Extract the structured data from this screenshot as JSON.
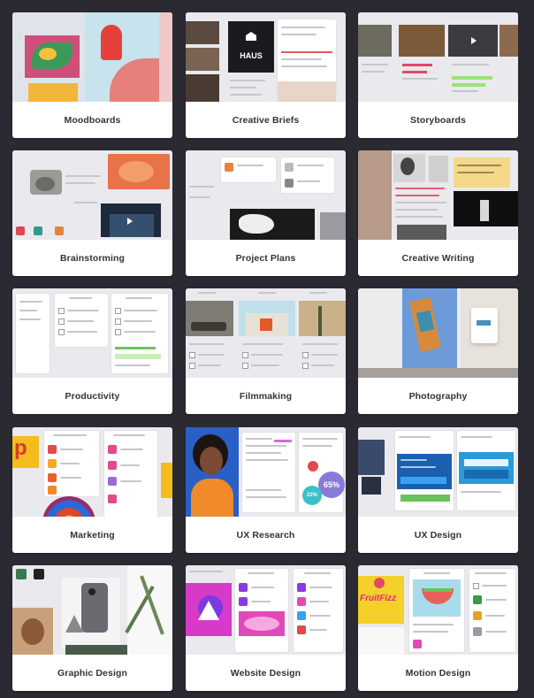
{
  "cards": [
    {
      "id": "moodboards",
      "label": "Moodboards"
    },
    {
      "id": "creative-briefs",
      "label": "Creative Briefs",
      "thumb_text": "HAUS"
    },
    {
      "id": "storyboards",
      "label": "Storyboards"
    },
    {
      "id": "brainstorming",
      "label": "Brainstorming"
    },
    {
      "id": "project-plans",
      "label": "Project Plans"
    },
    {
      "id": "creative-writing",
      "label": "Creative Writing"
    },
    {
      "id": "productivity",
      "label": "Productivity"
    },
    {
      "id": "filmmaking",
      "label": "Filmmaking"
    },
    {
      "id": "photography",
      "label": "Photography"
    },
    {
      "id": "marketing",
      "label": "Marketing",
      "thumb_text": "p"
    },
    {
      "id": "ux-research",
      "label": "UX Research",
      "thumb_text": "65%",
      "thumb_text2": "22%"
    },
    {
      "id": "ux-design",
      "label": "UX Design"
    },
    {
      "id": "graphic-design",
      "label": "Graphic Design"
    },
    {
      "id": "website-design",
      "label": "Website Design"
    },
    {
      "id": "motion-design",
      "label": "Motion Design",
      "thumb_text": "FruitFizz"
    }
  ],
  "colors": {
    "background": "#2b2a33",
    "card": "#ffffff",
    "label": "#333333"
  }
}
